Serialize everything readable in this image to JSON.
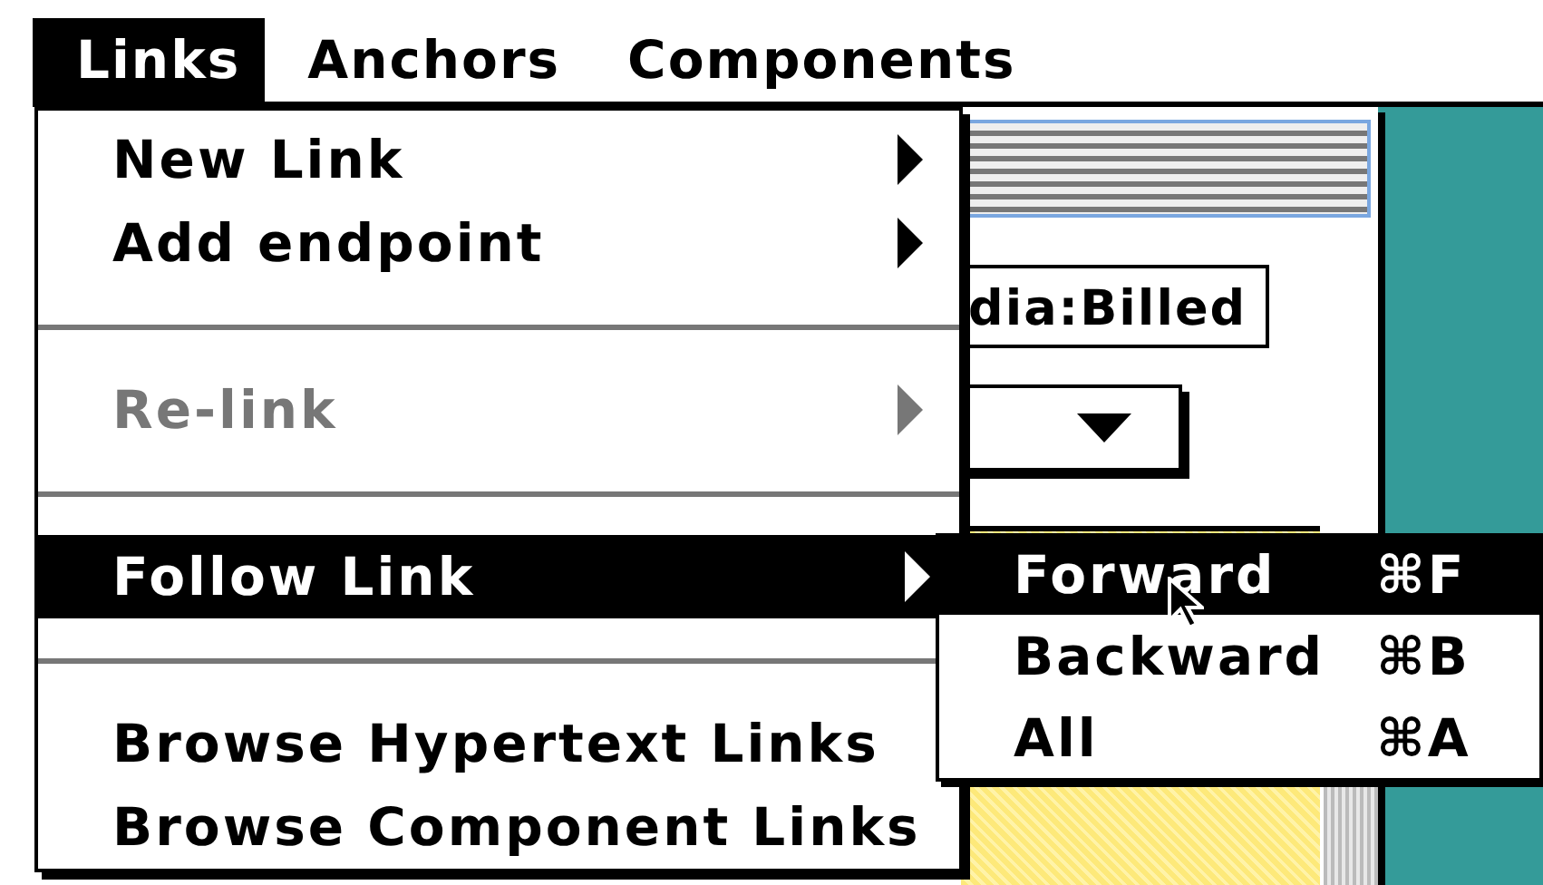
{
  "menu_bar": {
    "menus": [
      {
        "label": "Links",
        "selected": true
      },
      {
        "label": "Anchors",
        "selected": false
      },
      {
        "label": "Components",
        "selected": false
      }
    ]
  },
  "menu": {
    "items": [
      {
        "kind": "item",
        "label": "New Link",
        "submenu": true,
        "disabled": false,
        "selected": false
      },
      {
        "kind": "item",
        "label": "Add endpoint",
        "submenu": true,
        "disabled": false,
        "selected": false
      },
      {
        "kind": "separator"
      },
      {
        "kind": "item",
        "label": "Re-link",
        "submenu": true,
        "disabled": true,
        "selected": false
      },
      {
        "kind": "separator"
      },
      {
        "kind": "item",
        "label": "Follow Link",
        "submenu": true,
        "disabled": false,
        "selected": true
      },
      {
        "kind": "separator"
      },
      {
        "kind": "item",
        "label": "Browse Hypertext Links",
        "submenu": false,
        "disabled": false,
        "selected": false
      },
      {
        "kind": "item",
        "label": "Browse Component Links",
        "submenu": false,
        "disabled": false,
        "selected": false
      }
    ]
  },
  "submenu": {
    "items": [
      {
        "label": "Forward",
        "shortcut": "⌘F",
        "selected": true
      },
      {
        "label": "Backward",
        "shortcut": "⌘B",
        "selected": false
      },
      {
        "label": "All",
        "shortcut": "⌘A",
        "selected": false
      }
    ]
  },
  "background_window": {
    "field_value": "dia:Billed"
  }
}
